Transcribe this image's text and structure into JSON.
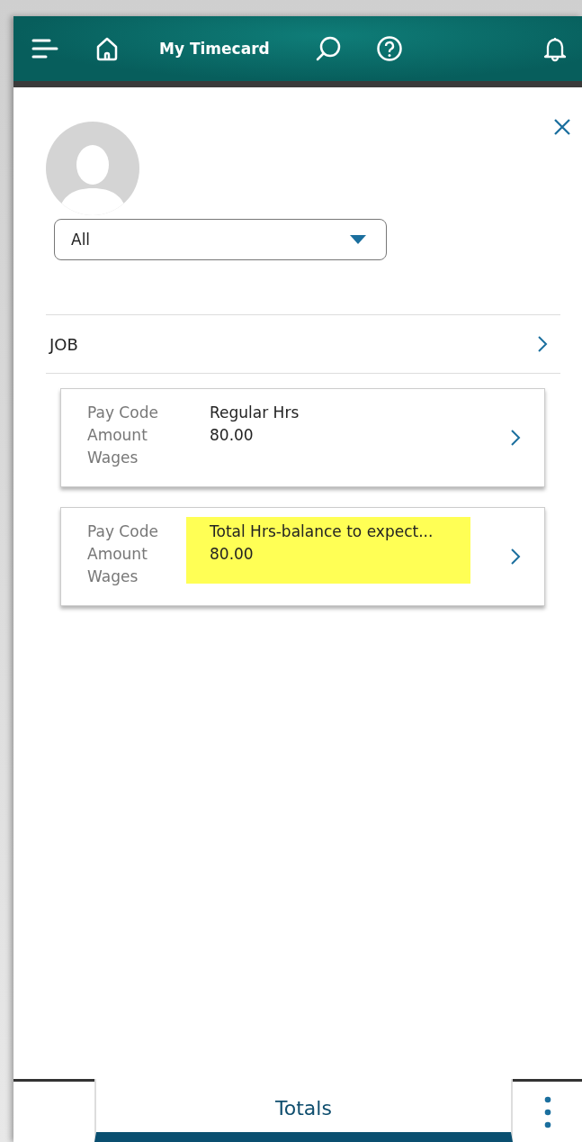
{
  "header": {
    "title": "My Timecard"
  },
  "filter": {
    "value": "All"
  },
  "section": {
    "label": "JOB"
  },
  "cards": [
    {
      "labels": [
        "Pay Code",
        "Amount",
        "Wages"
      ],
      "values": [
        "Regular Hrs",
        "80.00"
      ],
      "highlighted": false
    },
    {
      "labels": [
        "Pay Code",
        "Amount",
        "Wages"
      ],
      "values": [
        "Total Hrs-balance to expect...",
        "80.00"
      ],
      "highlighted": true
    }
  ],
  "tabs": [
    {
      "label": "Totals",
      "selected": true
    }
  ]
}
